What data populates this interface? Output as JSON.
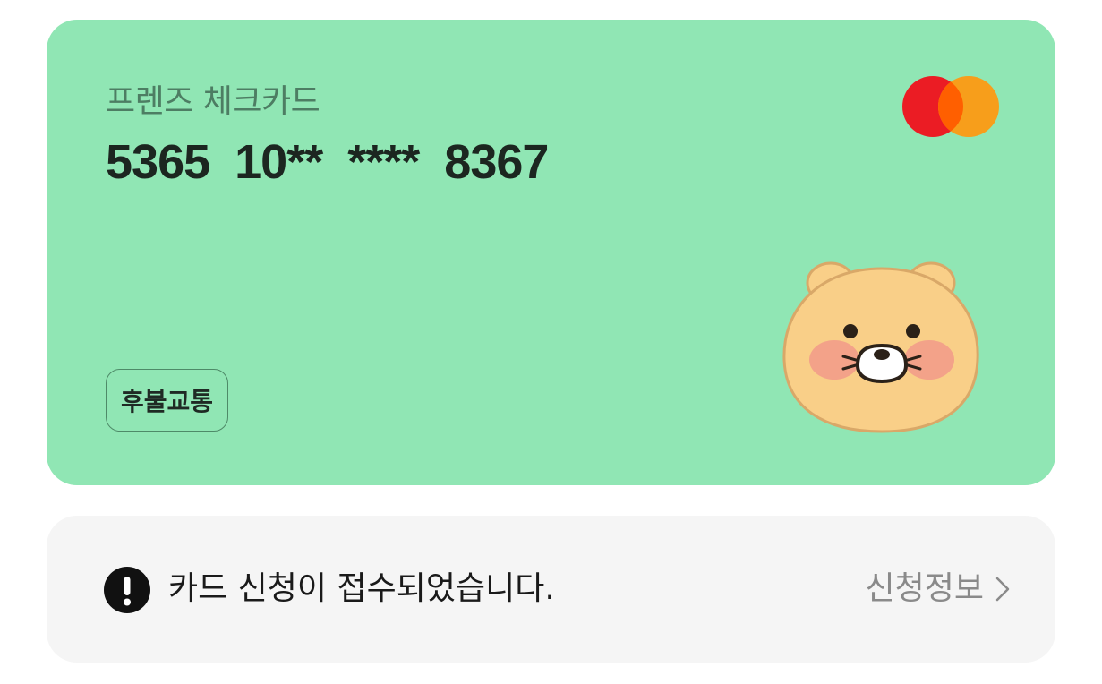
{
  "card": {
    "name": "프렌즈 체크카드",
    "number": "5365  10**  ****  8367",
    "badge": "후불교통",
    "brand_icon": "mastercard-logo",
    "mascot_icon": "choonsik-character",
    "background_color": "#90e6b4"
  },
  "notice": {
    "icon": "alert-circle-icon",
    "message": "카드 신청이 접수되었습니다.",
    "link_label": "신청정보",
    "link_icon": "chevron-right-icon"
  }
}
